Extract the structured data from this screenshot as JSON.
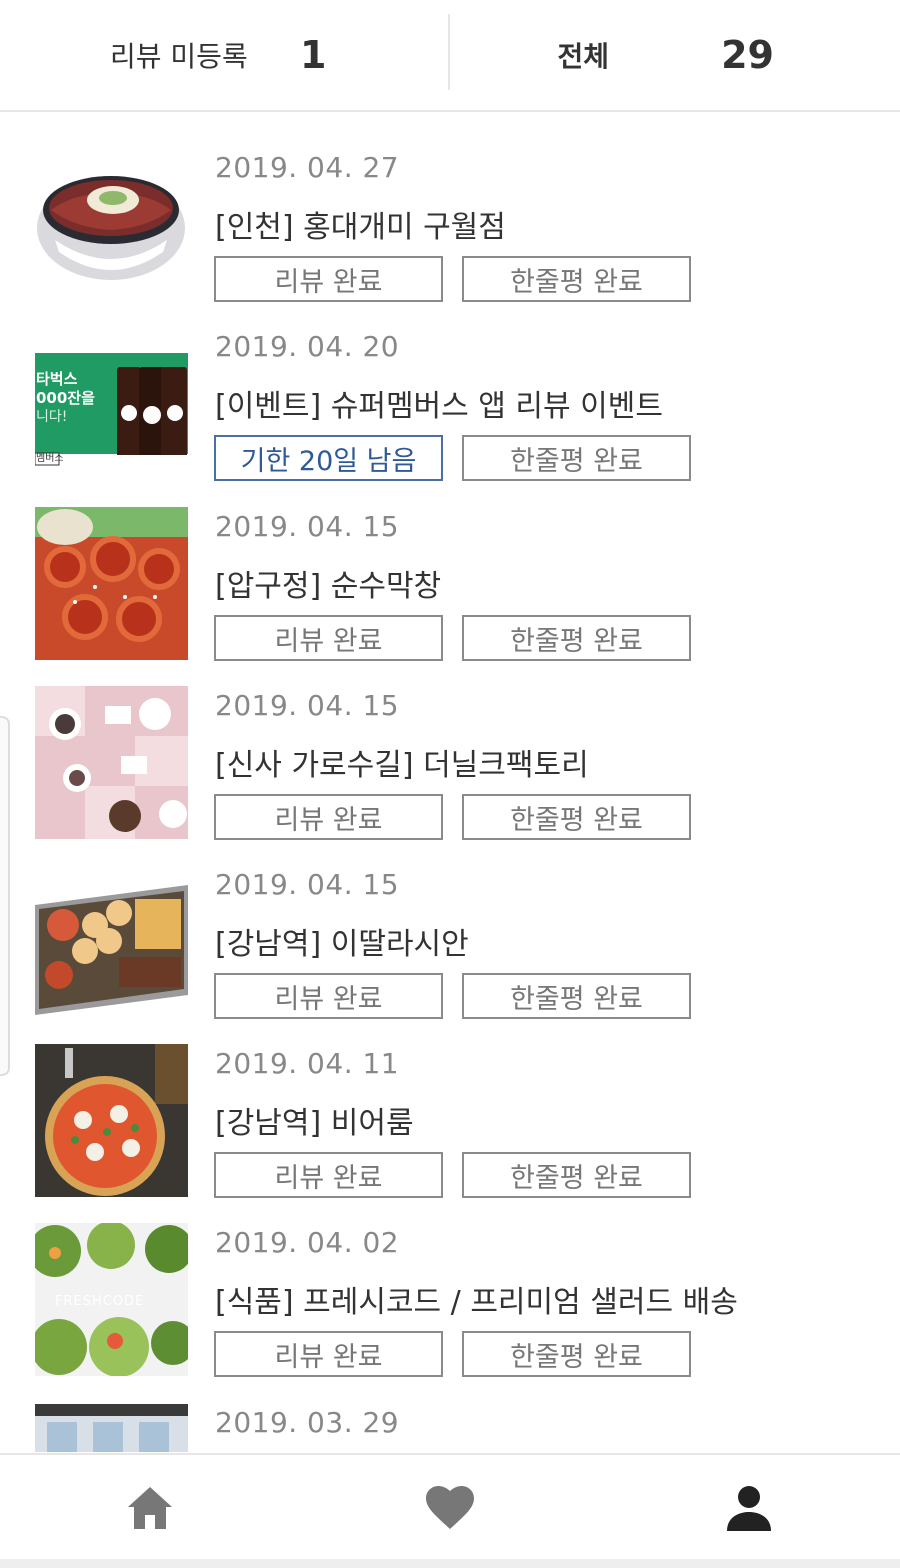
{
  "summary": {
    "unregistered_label": "리뷰 미등록",
    "unregistered_count": "1",
    "total_label": "전체",
    "total_count": "29"
  },
  "items": [
    {
      "date": "2019. 04. 27",
      "title": "[인천] 홍대개미 구월점",
      "left_button": "리뷰 완료",
      "right_button": "한줄평 완료"
    },
    {
      "date": "2019. 04. 20",
      "title": "[이벤트] 슈퍼멤버스 앱 리뷰 이벤트",
      "left_button": "기한 20일 남음",
      "right_button": "한줄평 완료",
      "thumb_text": [
        "타벅스",
        "000잔을",
        "니다!",
        "멤버스"
      ]
    },
    {
      "date": "2019. 04. 15",
      "title": "[압구정] 순수막창",
      "left_button": "리뷰 완료",
      "right_button": "한줄평 완료"
    },
    {
      "date": "2019. 04. 15",
      "title": "[신사 가로수길] 더닐크팩토리",
      "left_button": "리뷰 완료",
      "right_button": "한줄평 완료"
    },
    {
      "date": "2019. 04. 15",
      "title": "[강남역] 이딸라시안",
      "left_button": "리뷰 완료",
      "right_button": "한줄평 완료"
    },
    {
      "date": "2019. 04. 11",
      "title": "[강남역] 비어룸",
      "left_button": "리뷰 완료",
      "right_button": "한줄평 완료"
    },
    {
      "date": "2019. 04. 02",
      "title": "[식품] 프레시코드 / 프리미엄 샐러드 배송",
      "left_button": "리뷰 완료",
      "right_button": "한줄평 완료",
      "thumb_text": [
        "FRESHCODE"
      ]
    },
    {
      "date": "2019. 03. 29"
    }
  ],
  "nav": {
    "home_icon": "home-icon",
    "heart_icon": "heart-icon",
    "profile_icon": "person-icon"
  },
  "colors": {
    "accent_blue": "#2f5a97",
    "icon_gray": "#777777",
    "icon_dark": "#222222"
  }
}
